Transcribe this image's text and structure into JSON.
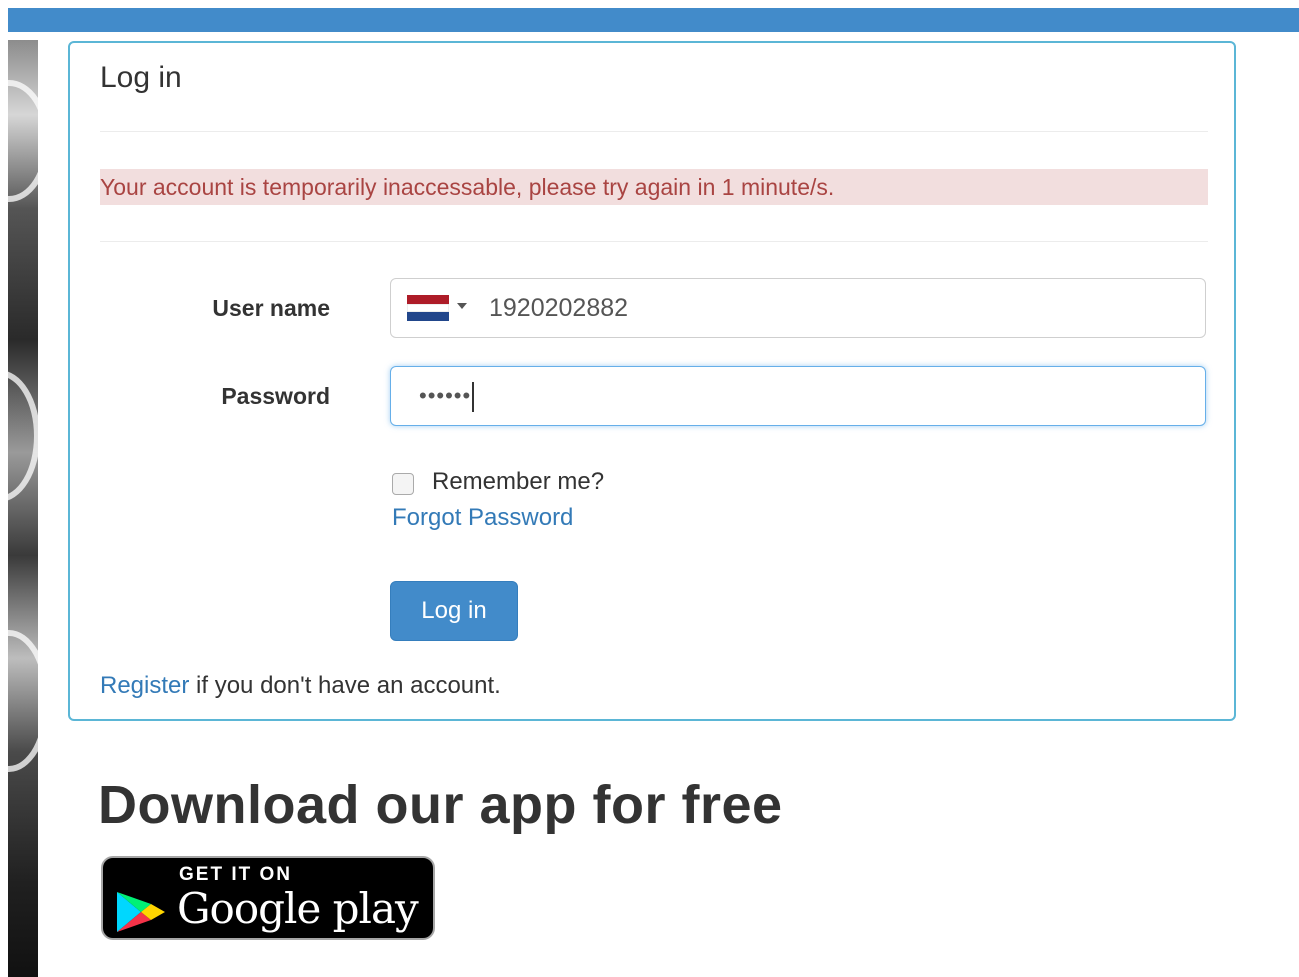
{
  "login": {
    "title": "Log in",
    "alert": "Your account is temporarily inaccessable, please try again in 1 minute/s.",
    "username_label": "User name",
    "username_value": "1920202882",
    "password_label": "Password",
    "password_masked": "••••••",
    "remember_label": "Remember me?",
    "forgot_label": "Forgot Password",
    "submit_label": "Log in",
    "register_link": "Register",
    "register_suffix": " if you don't have an account."
  },
  "download": {
    "title": "Download our app for free",
    "badge_small": "GET IT ON",
    "badge_big": "Google play"
  },
  "icons": {
    "country_flag": "netherlands-flag-icon",
    "dropdown": "caret-down-icon",
    "play_store": "google-play-icon"
  },
  "colors": {
    "brand_primary": "#428bca",
    "panel_border": "#5bb6d6",
    "alert_bg": "#f2dede",
    "alert_text": "#a94442",
    "link": "#337ab7",
    "flag_red": "#ae1c28",
    "flag_white": "#ffffff",
    "flag_blue": "#21468b"
  }
}
